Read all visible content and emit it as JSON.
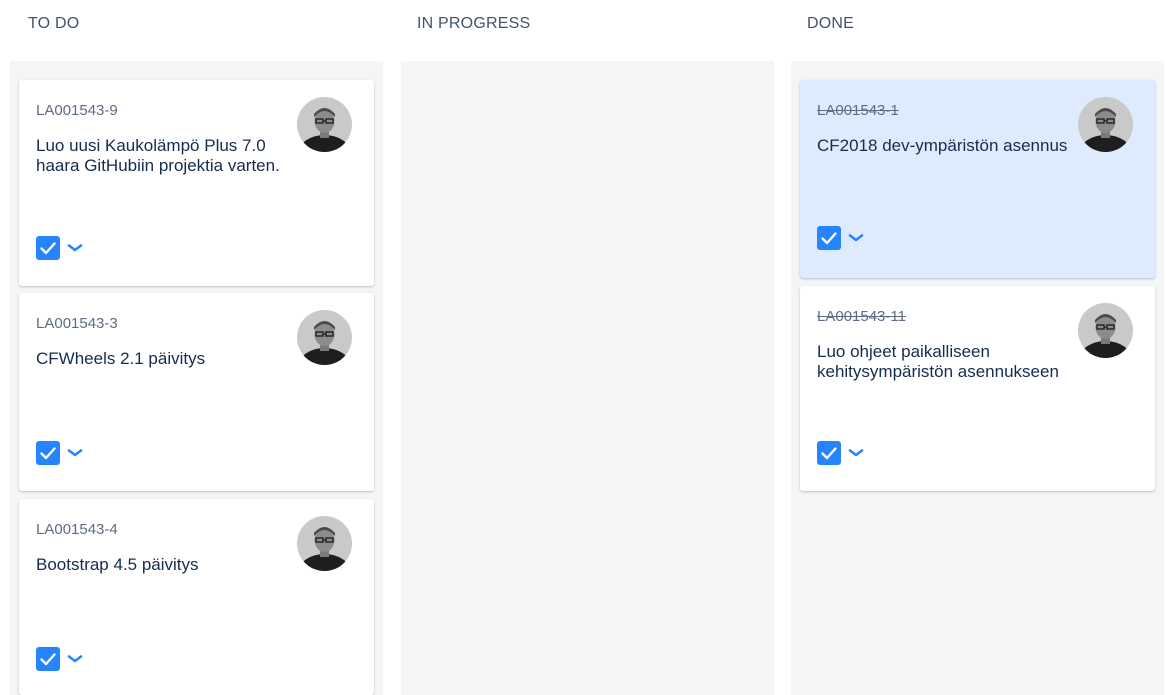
{
  "columns": [
    {
      "title": "TO DO",
      "cards": [
        {
          "key": "LA001543-9",
          "summary": "Luo uusi Kaukolämpö Plus 7.0 haara GitHubiin projektia varten.",
          "done": false
        },
        {
          "key": "LA001543-3",
          "summary": "CFWheels 2.1 päivitys",
          "done": false
        },
        {
          "key": "LA001543-4",
          "summary": "Bootstrap 4.5 päivitys",
          "done": false
        }
      ]
    },
    {
      "title": "IN PROGRESS",
      "cards": []
    },
    {
      "title": "DONE",
      "cards": [
        {
          "key": "LA001543-1",
          "summary": "CF2018 dev-ympäristön asennus",
          "done": true,
          "selected": true
        },
        {
          "key": "LA001543-11",
          "summary": "Luo ohjeet paikalliseen kehitysympäristön asennukseen",
          "done": true
        }
      ]
    }
  ],
  "icons": {
    "issue_type": "checkbox-task-icon",
    "priority": "chevron-down-icon",
    "assignee": "avatar"
  },
  "colors": {
    "column_bg": "#f4f5f7",
    "card_bg": "#ffffff",
    "selected_card_bg": "#deebff",
    "task_icon": "#2684ff",
    "priority_icon": "#2684ff",
    "key_text": "#5e6c84",
    "summary_text": "#172b4d",
    "header_text": "#42526e"
  }
}
